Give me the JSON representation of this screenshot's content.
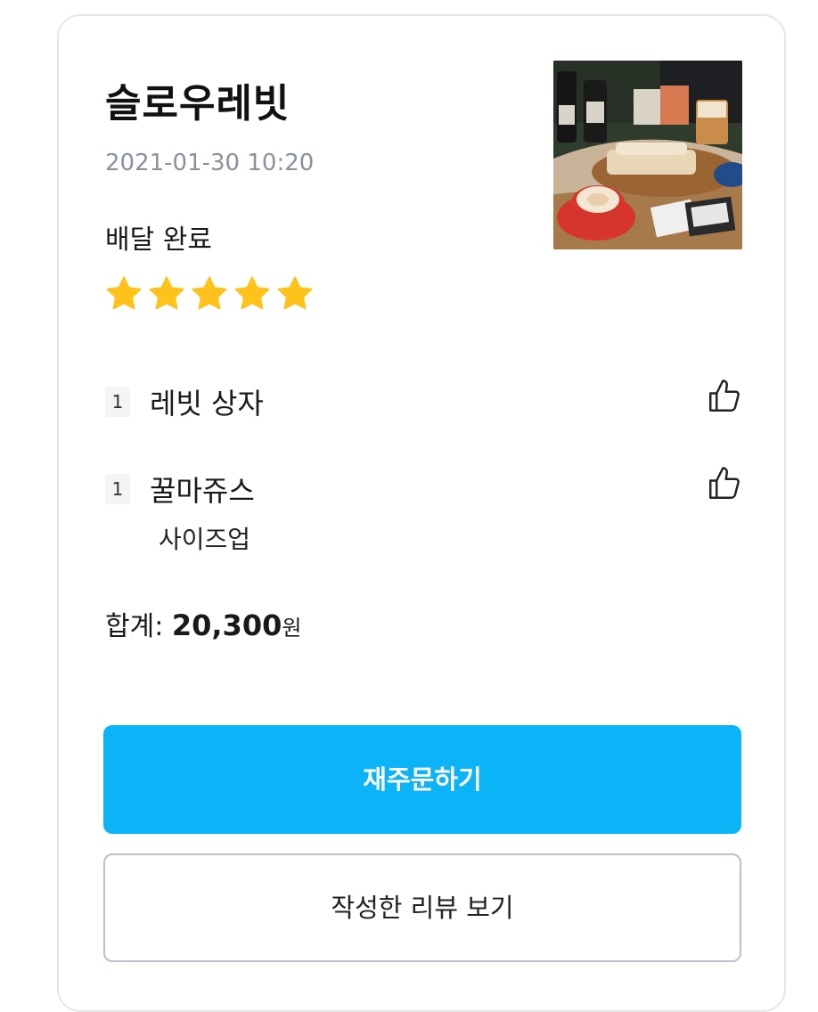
{
  "order": {
    "store_name": "슬로우레빗",
    "date": "2021-01-30 10:20",
    "status": "배달 완료",
    "rating": 5,
    "rating_max": 5,
    "thumbnail_icon": "store-food-photo"
  },
  "items": [
    {
      "qty": "1",
      "name": "레빗 상자",
      "options": []
    },
    {
      "qty": "1",
      "name": "꿀마쥬스",
      "options": [
        "사이즈업"
      ]
    }
  ],
  "total": {
    "label": "합계:",
    "amount": "20,300",
    "unit": "원"
  },
  "buttons": {
    "reorder": "재주문하기",
    "view_review": "작성한 리뷰 보기"
  },
  "colors": {
    "star": "#FFC21A",
    "primary": "#0BB4F6",
    "muted_text": "#8A919C"
  }
}
